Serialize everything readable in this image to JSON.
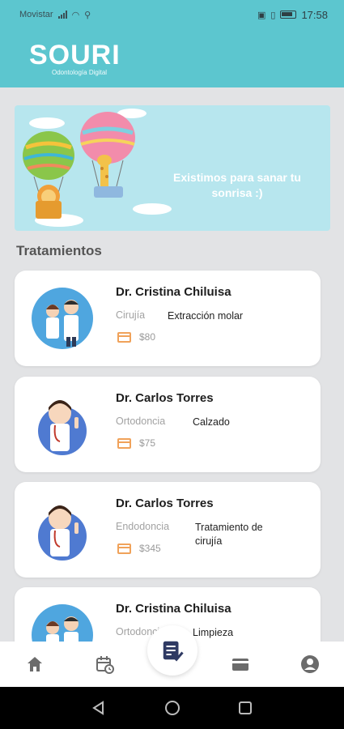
{
  "status_bar": {
    "carrier": "Movistar",
    "time": "17:58"
  },
  "header": {
    "logo_main": "SOURI",
    "logo_sub": "Odontología Digital"
  },
  "banner": {
    "text": "Existimos para sanar tu sonrisa :)"
  },
  "section": {
    "title": "Tratamientos"
  },
  "treatments": [
    {
      "doctor": "Dr. Cristina Chiluisa",
      "specialty": "Cirujía",
      "treatment": "Extracción molar",
      "price": "$80"
    },
    {
      "doctor": "Dr. Carlos Torres",
      "specialty": "Ortodoncia",
      "treatment": "Calzado",
      "price": "$75"
    },
    {
      "doctor": "Dr. Carlos Torres",
      "specialty": "Endodoncia",
      "treatment": "Tratamiento de cirujía",
      "price": "$345"
    },
    {
      "doctor": "Dr. Cristina Chiluisa",
      "specialty": "Ortodoncia",
      "treatment": "Limpieza",
      "price": "$"
    }
  ],
  "colors": {
    "brand_teal": "#5cc6cf",
    "price_icon": "#f0a25a",
    "nav_icon": "#6b6b6b"
  },
  "nav": {
    "items": [
      "home-icon",
      "calendar-icon",
      "treatments-icon",
      "payment-card-icon",
      "profile-icon"
    ],
    "active": "treatments-icon"
  }
}
